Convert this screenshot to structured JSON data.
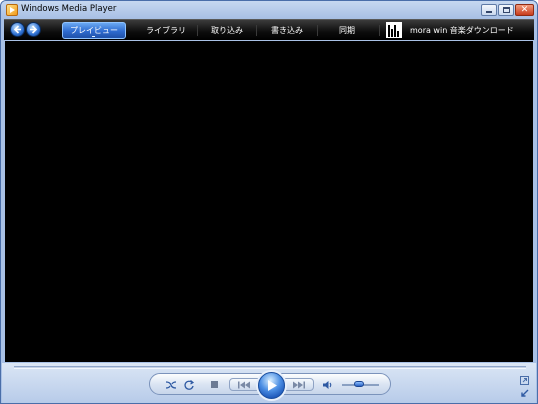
{
  "window": {
    "title": "Windows Media Player"
  },
  "titlebar": {
    "minimize_icon": "minimize-icon",
    "maximize_icon": "maximize-icon",
    "close_icon": "close-icon",
    "close_glyph": "✕"
  },
  "nav": {
    "back_icon": "back-arrow-icon",
    "forward_icon": "forward-arrow-icon",
    "tabs": [
      {
        "label": "プレイビュー",
        "active": true
      },
      {
        "label": "ライブラリ",
        "active": false
      },
      {
        "label": "取り込み",
        "active": false
      },
      {
        "label": "書き込み",
        "active": false
      },
      {
        "label": "同期",
        "active": false
      }
    ],
    "store_logo_icon": "mora-logo-icon",
    "store_label": "mora win 音楽ダウンロード"
  },
  "playback": {
    "shuffle_icon": "shuffle-icon",
    "repeat_icon": "repeat-icon",
    "stop_icon": "stop-icon",
    "previous_icon": "previous-icon",
    "play_icon": "play-icon",
    "next_icon": "next-icon",
    "mute_icon": "volume-icon",
    "volume_level": 0.45,
    "fullscreen_icon": "fullscreen-icon",
    "compact_mode_icon": "compact-mode-icon"
  },
  "colors": {
    "accent": "#2e6bcf",
    "video_background": "#000000",
    "navbar_background": "#0d0d0d"
  }
}
